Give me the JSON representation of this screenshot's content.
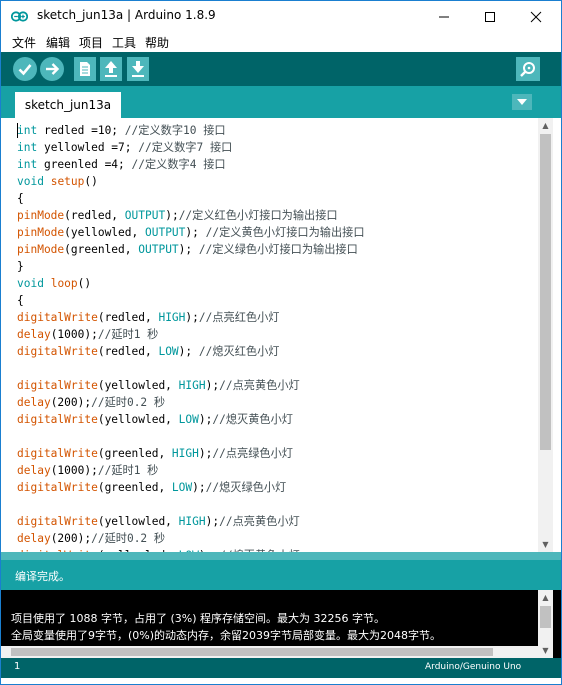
{
  "window": {
    "title": "sketch_jun13a | Arduino 1.8.9",
    "icon": "arduino-logo-icon"
  },
  "menu": [
    "文件",
    "编辑",
    "项目",
    "工具",
    "帮助"
  ],
  "toolbar": {
    "buttons": [
      "verify-icon",
      "upload-icon",
      "new-icon",
      "open-icon",
      "save-icon"
    ],
    "serial_monitor_icon": "magnifier-icon"
  },
  "tab": {
    "label": "sketch_jun13a"
  },
  "code_lines": [
    [
      {
        "t": "int",
        "c": "kw"
      },
      {
        "t": " redled =10; "
      },
      {
        "t": "//定义数字10 接口",
        "c": "cm"
      }
    ],
    [
      {
        "t": "int",
        "c": "kw"
      },
      {
        "t": " yellowled =7; "
      },
      {
        "t": "//定义数字7 接口",
        "c": "cm"
      }
    ],
    [
      {
        "t": "int",
        "c": "kw"
      },
      {
        "t": " greenled =4; "
      },
      {
        "t": "//定义数字4 接口",
        "c": "cm"
      }
    ],
    [
      {
        "t": "void",
        "c": "kw"
      },
      {
        "t": " "
      },
      {
        "t": "setup",
        "c": "fn"
      },
      {
        "t": "()"
      }
    ],
    [
      {
        "t": "{"
      }
    ],
    [
      {
        "t": "pinMode",
        "c": "fn"
      },
      {
        "t": "(redled, "
      },
      {
        "t": "OUTPUT",
        "c": "const"
      },
      {
        "t": ");"
      },
      {
        "t": "//定义红色小灯接口为输出接口",
        "c": "cm"
      }
    ],
    [
      {
        "t": "pinMode",
        "c": "fn"
      },
      {
        "t": "(yellowled, "
      },
      {
        "t": "OUTPUT",
        "c": "const"
      },
      {
        "t": "); "
      },
      {
        "t": "//定义黄色小灯接口为输出接口",
        "c": "cm"
      }
    ],
    [
      {
        "t": "pinMode",
        "c": "fn"
      },
      {
        "t": "(greenled, "
      },
      {
        "t": "OUTPUT",
        "c": "const"
      },
      {
        "t": "); "
      },
      {
        "t": "//定义绿色小灯接口为输出接口",
        "c": "cm"
      }
    ],
    [
      {
        "t": "}"
      }
    ],
    [
      {
        "t": "void",
        "c": "kw"
      },
      {
        "t": " "
      },
      {
        "t": "loop",
        "c": "fn"
      },
      {
        "t": "()"
      }
    ],
    [
      {
        "t": "{"
      }
    ],
    [
      {
        "t": "digitalWrite",
        "c": "fn"
      },
      {
        "t": "(redled, "
      },
      {
        "t": "HIGH",
        "c": "const"
      },
      {
        "t": ");"
      },
      {
        "t": "//点亮红色小灯",
        "c": "cm"
      }
    ],
    [
      {
        "t": "delay",
        "c": "fn"
      },
      {
        "t": "(1000);"
      },
      {
        "t": "//延时1 秒",
        "c": "cm"
      }
    ],
    [
      {
        "t": "digitalWrite",
        "c": "fn"
      },
      {
        "t": "(redled, "
      },
      {
        "t": "LOW",
        "c": "const"
      },
      {
        "t": "); "
      },
      {
        "t": "//熄灭红色小灯",
        "c": "cm"
      }
    ],
    [],
    [
      {
        "t": "digitalWrite",
        "c": "fn"
      },
      {
        "t": "(yellowled, "
      },
      {
        "t": "HIGH",
        "c": "const"
      },
      {
        "t": ");"
      },
      {
        "t": "//点亮黄色小灯",
        "c": "cm"
      }
    ],
    [
      {
        "t": "delay",
        "c": "fn"
      },
      {
        "t": "(200);"
      },
      {
        "t": "//延时0.2 秒",
        "c": "cm"
      }
    ],
    [
      {
        "t": "digitalWrite",
        "c": "fn"
      },
      {
        "t": "(yellowled, "
      },
      {
        "t": "LOW",
        "c": "const"
      },
      {
        "t": ");"
      },
      {
        "t": "//熄灭黄色小灯",
        "c": "cm"
      }
    ],
    [],
    [
      {
        "t": "digitalWrite",
        "c": "fn"
      },
      {
        "t": "(greenled, "
      },
      {
        "t": "HIGH",
        "c": "const"
      },
      {
        "t": ");"
      },
      {
        "t": "//点亮绿色小灯",
        "c": "cm"
      }
    ],
    [
      {
        "t": "delay",
        "c": "fn"
      },
      {
        "t": "(1000);"
      },
      {
        "t": "//延时1 秒",
        "c": "cm"
      }
    ],
    [
      {
        "t": "digitalWrite",
        "c": "fn"
      },
      {
        "t": "(greenled, "
      },
      {
        "t": "LOW",
        "c": "const"
      },
      {
        "t": ");"
      },
      {
        "t": "//熄灭绿色小灯",
        "c": "cm"
      }
    ],
    [],
    [
      {
        "t": "digitalWrite",
        "c": "fn"
      },
      {
        "t": "(yellowled, "
      },
      {
        "t": "HIGH",
        "c": "const"
      },
      {
        "t": ");"
      },
      {
        "t": "//点亮黄色小灯",
        "c": "cm"
      }
    ],
    [
      {
        "t": "delay",
        "c": "fn"
      },
      {
        "t": "(200);"
      },
      {
        "t": "//延时0.2 秒",
        "c": "cm"
      }
    ],
    [
      {
        "t": "digitalWrite",
        "c": "fn"
      },
      {
        "t": "(yellowled, "
      },
      {
        "t": "LOW",
        "c": "const"
      },
      {
        "t": "); "
      },
      {
        "t": "//熄灭黄色小灯",
        "c": "cm"
      }
    ]
  ],
  "status": {
    "message": "编译完成。"
  },
  "console": {
    "lines": [
      "项目使用了 1088 字节，占用了 (3%) 程序存储空间。最大为 32256 字节。",
      "全局变量使用了9字节，(0%)的动态内存，余留2039字节局部变量。最大为2048字节。"
    ]
  },
  "footer": {
    "line_number": "1",
    "board": "Arduino/Genuino Uno"
  },
  "colors": {
    "toolbar": "#006468",
    "tab_bar": "#17a1a5",
    "button": "#4db7bb",
    "keyword": "#00979c",
    "function": "#d35400",
    "comment": "#434f54",
    "console_bg": "#000000"
  }
}
